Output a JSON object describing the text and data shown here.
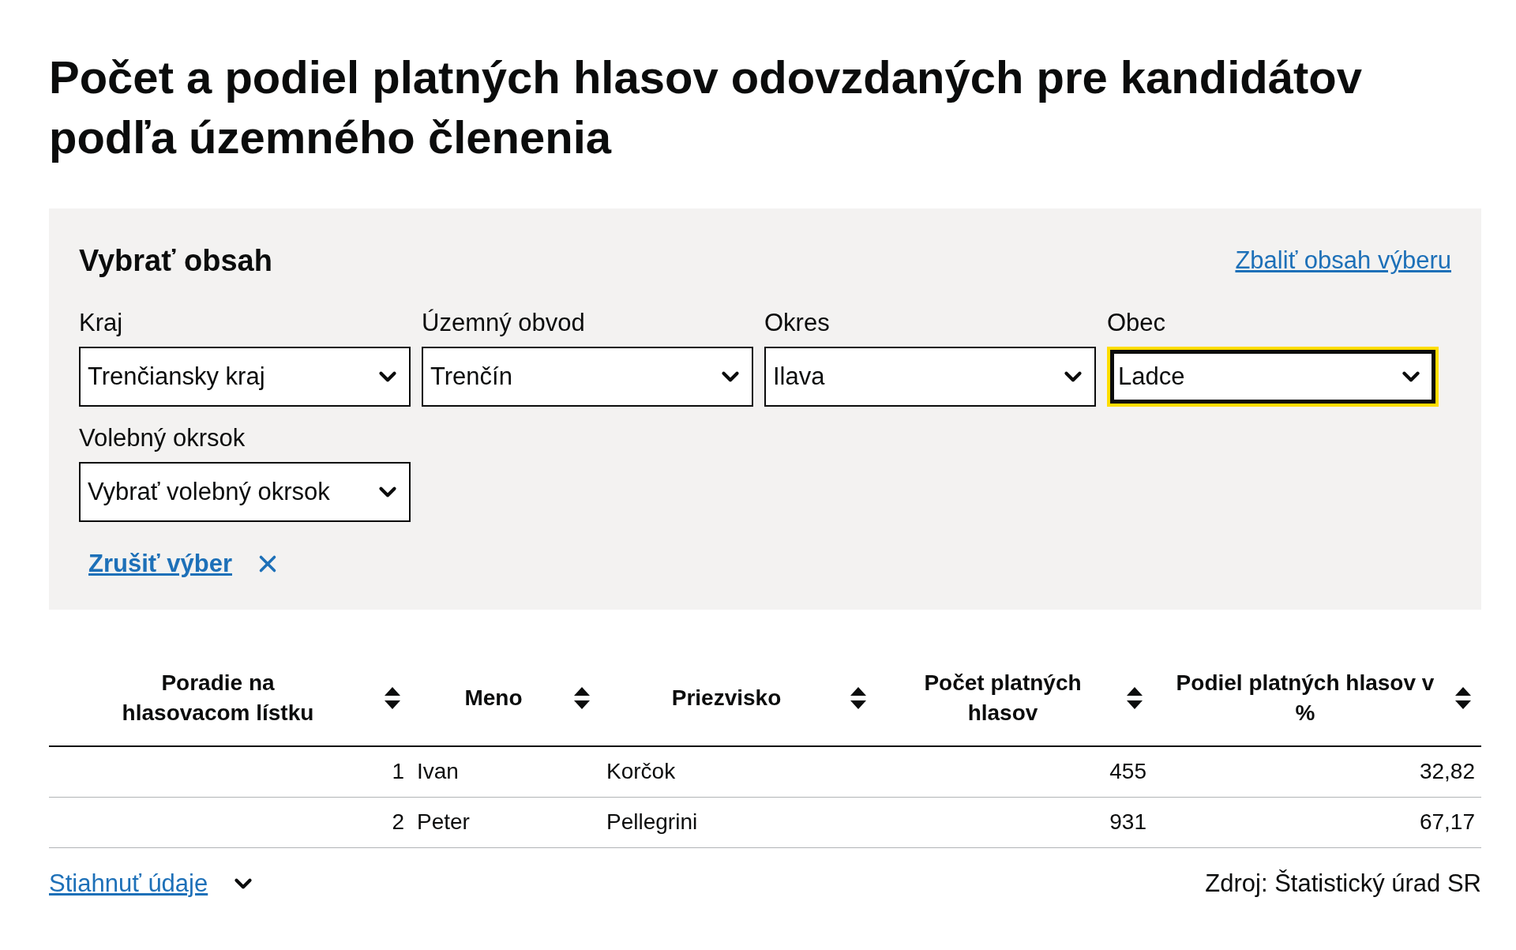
{
  "title": "Počet a podiel platných hlasov odovzdaných pre kandidátov podľa územného členenia",
  "filter_panel": {
    "heading": "Vybrať obsah",
    "collapse_link": "Zbaliť obsah výberu",
    "selects": [
      {
        "label": "Kraj",
        "value": "Trenčiansky kraj",
        "focused": false
      },
      {
        "label": "Územný obvod",
        "value": "Trenčín",
        "focused": false
      },
      {
        "label": "Okres",
        "value": "Ilava",
        "focused": false
      },
      {
        "label": "Obec",
        "value": "Ladce",
        "focused": true
      },
      {
        "label": "Volebný okrsok",
        "value": "Vybrať volebný okrsok",
        "focused": false
      }
    ],
    "clear_link": "Zrušiť výber"
  },
  "table": {
    "columns": [
      "Poradie na hlasovacom lístku",
      "Meno",
      "Priezvisko",
      "Počet platných hlasov",
      "Podiel platných hlasov v %"
    ],
    "rows": [
      [
        "1",
        "Ivan",
        "Korčok",
        "455",
        "32,82"
      ],
      [
        "2",
        "Peter",
        "Pellegrini",
        "931",
        "67,17"
      ]
    ]
  },
  "footer": {
    "download_link": "Stiahnuť údaje",
    "source": "Zdroj: Štatistický úrad SR"
  }
}
